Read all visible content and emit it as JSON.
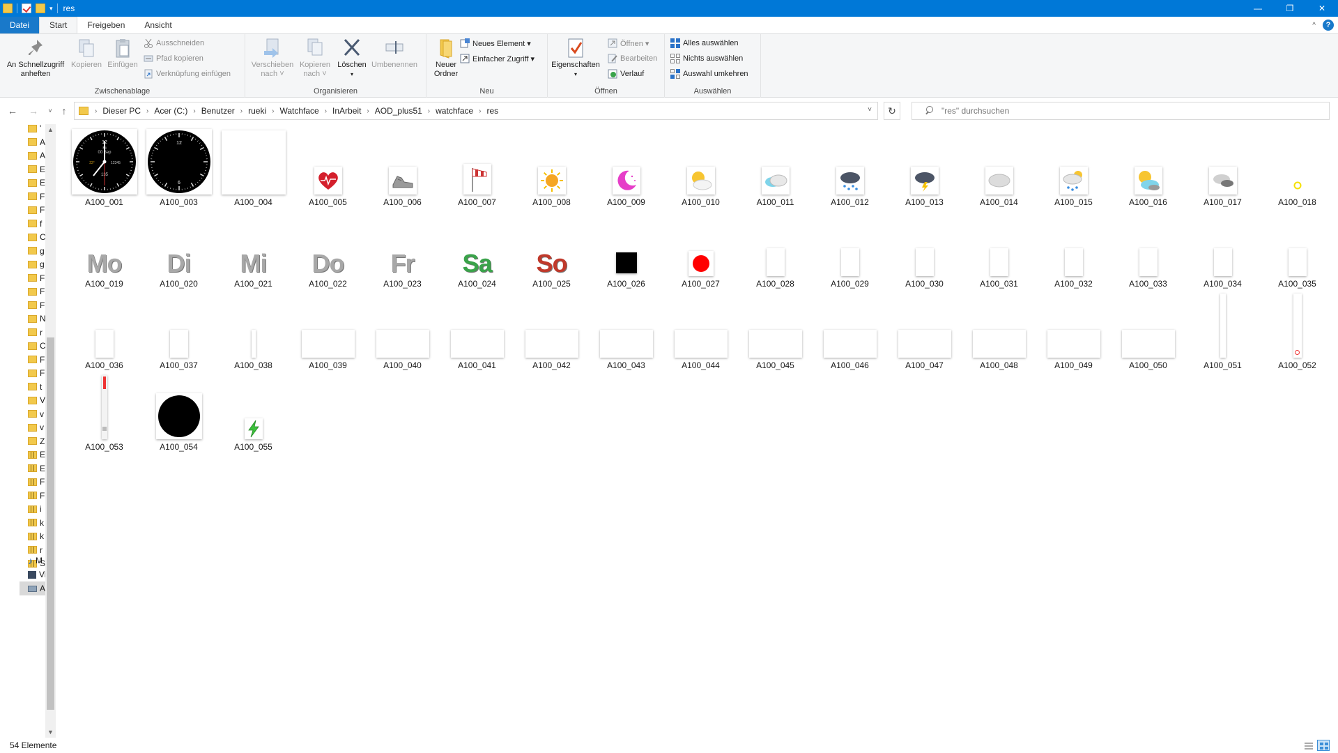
{
  "window": {
    "title": "res",
    "minimize": "—",
    "restore": "❐",
    "close": "✕"
  },
  "tabs": {
    "file": "Datei",
    "start": "Start",
    "share": "Freigeben",
    "view": "Ansicht"
  },
  "ribbon": {
    "clipboard": {
      "label": "Zwischenablage",
      "pin": "An Schnellzugriff\nanheften",
      "copy": "Kopieren",
      "paste": "Einfügen",
      "cut": "Ausschneiden",
      "copy_path": "Pfad kopieren",
      "paste_shortcut": "Verknüpfung einfügen"
    },
    "organize": {
      "label": "Organisieren",
      "move_to": "Verschieben\nnach ˅",
      "copy_to": "Kopieren\nnach ˅",
      "delete": "Löschen",
      "rename": "Umbenennen"
    },
    "new": {
      "label": "Neu",
      "new_folder": "Neuer\nOrdner",
      "new_item": "Neues Element ▾",
      "easy_access": "Einfacher Zugriff ▾"
    },
    "open": {
      "label": "Öffnen",
      "properties": "Eigenschaften",
      "open": "Öffnen ▾",
      "edit": "Bearbeiten",
      "history": "Verlauf"
    },
    "select": {
      "label": "Auswählen",
      "select_all": "Alles auswählen",
      "select_none": "Nichts auswählen",
      "invert": "Auswahl umkehren"
    }
  },
  "address": {
    "crumbs": [
      "Dieser PC",
      "Acer (C:)",
      "Benutzer",
      "rueki",
      "Watchface",
      "InArbeit",
      "AOD_plus51",
      "watchface",
      "res"
    ]
  },
  "search": {
    "placeholder": "\"res\" durchsuchen"
  },
  "navpane": {
    "items": [
      "'",
      "A",
      "A",
      "E",
      "E",
      "F",
      "F",
      "f",
      "C",
      "g",
      "g",
      "F",
      "F",
      "F",
      "N",
      "r",
      "C",
      "F",
      "F",
      "t",
      "V",
      "v",
      "v",
      "Z",
      "E",
      "E",
      "F",
      "F",
      "i",
      "k",
      "k",
      "r",
      "S",
      "M",
      "Vi",
      "Ac"
    ]
  },
  "files": [
    {
      "name": "A100_001",
      "kind": "watch_full"
    },
    {
      "name": "A100_003",
      "kind": "watch_bg"
    },
    {
      "name": "A100_004",
      "kind": "blank_large"
    },
    {
      "name": "A100_005",
      "kind": "heart"
    },
    {
      "name": "A100_006",
      "kind": "shoe"
    },
    {
      "name": "A100_007",
      "kind": "windsock"
    },
    {
      "name": "A100_008",
      "kind": "sun"
    },
    {
      "name": "A100_009",
      "kind": "moon"
    },
    {
      "name": "A100_010",
      "kind": "sun_cloud"
    },
    {
      "name": "A100_011",
      "kind": "cloud_blue"
    },
    {
      "name": "A100_012",
      "kind": "rain_dark"
    },
    {
      "name": "A100_013",
      "kind": "storm"
    },
    {
      "name": "A100_014",
      "kind": "cloud_grey"
    },
    {
      "name": "A100_015",
      "kind": "snow_sun"
    },
    {
      "name": "A100_016",
      "kind": "sun_cloud2"
    },
    {
      "name": "A100_017",
      "kind": "cloud_dark"
    },
    {
      "name": "A100_018",
      "kind": "tiny_ring"
    },
    {
      "name": "A100_019",
      "kind": "word",
      "text": "Mo",
      "color": "#a8a8a8"
    },
    {
      "name": "A100_020",
      "kind": "word",
      "text": "Di",
      "color": "#a8a8a8"
    },
    {
      "name": "A100_021",
      "kind": "word",
      "text": "Mi",
      "color": "#a8a8a8"
    },
    {
      "name": "A100_022",
      "kind": "word",
      "text": "Do",
      "color": "#a8a8a8"
    },
    {
      "name": "A100_023",
      "kind": "word",
      "text": "Fr",
      "color": "#a8a8a8"
    },
    {
      "name": "A100_024",
      "kind": "word",
      "text": "Sa",
      "color": "#3aa34a"
    },
    {
      "name": "A100_025",
      "kind": "word",
      "text": "So",
      "color": "#c0392b"
    },
    {
      "name": "A100_026",
      "kind": "black_square"
    },
    {
      "name": "A100_027",
      "kind": "red_dot"
    },
    {
      "name": "A100_028",
      "kind": "blank_tall"
    },
    {
      "name": "A100_029",
      "kind": "blank_tall"
    },
    {
      "name": "A100_030",
      "kind": "blank_tall"
    },
    {
      "name": "A100_031",
      "kind": "blank_tall"
    },
    {
      "name": "A100_032",
      "kind": "blank_tall"
    },
    {
      "name": "A100_033",
      "kind": "blank_tall"
    },
    {
      "name": "A100_034",
      "kind": "blank_tall"
    },
    {
      "name": "A100_035",
      "kind": "blank_tall"
    },
    {
      "name": "A100_036",
      "kind": "blank_tall"
    },
    {
      "name": "A100_037",
      "kind": "blank_tall"
    },
    {
      "name": "A100_038",
      "kind": "blank_thin"
    },
    {
      "name": "A100_039",
      "kind": "blank_wide"
    },
    {
      "name": "A100_040",
      "kind": "blank_wide"
    },
    {
      "name": "A100_041",
      "kind": "blank_wide"
    },
    {
      "name": "A100_042",
      "kind": "blank_wide"
    },
    {
      "name": "A100_043",
      "kind": "blank_wide"
    },
    {
      "name": "A100_044",
      "kind": "blank_wide"
    },
    {
      "name": "A100_045",
      "kind": "blank_wide"
    },
    {
      "name": "A100_046",
      "kind": "blank_wide"
    },
    {
      "name": "A100_047",
      "kind": "blank_wide"
    },
    {
      "name": "A100_048",
      "kind": "blank_wide"
    },
    {
      "name": "A100_049",
      "kind": "blank_wide"
    },
    {
      "name": "A100_050",
      "kind": "blank_wide"
    },
    {
      "name": "A100_051",
      "kind": "bar_vertical"
    },
    {
      "name": "A100_052",
      "kind": "bar_vertical_dot"
    },
    {
      "name": "A100_053",
      "kind": "slider"
    },
    {
      "name": "A100_054",
      "kind": "black_circle"
    },
    {
      "name": "A100_055",
      "kind": "bolt"
    }
  ],
  "status": {
    "count": "54 Elemente"
  }
}
